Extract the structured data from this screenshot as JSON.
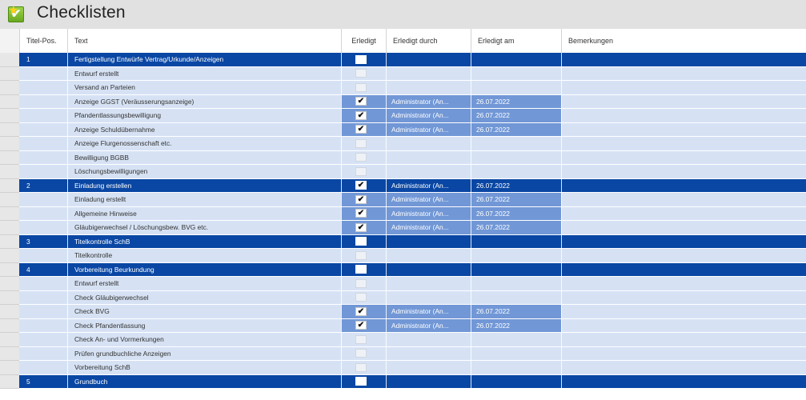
{
  "window": {
    "title": "Checklisten"
  },
  "columns": {
    "pos": "Titel-Pos.",
    "text": "Text",
    "done": "Erledigt",
    "done_by": "Erledigt durch",
    "done_at": "Erledigt am",
    "remarks": "Bemerkungen"
  },
  "rows": [
    {
      "kind": "group",
      "pos": "1",
      "text": "Fertigstellung Entwürfe Vertrag/Urkunde/Anzeigen",
      "checked": false,
      "by": "",
      "at": ""
    },
    {
      "kind": "item",
      "pos": "",
      "text": "Entwurf erstellt",
      "checked": false,
      "by": "",
      "at": ""
    },
    {
      "kind": "item",
      "pos": "",
      "text": "Versand an Parteien",
      "checked": false,
      "by": "",
      "at": ""
    },
    {
      "kind": "item",
      "pos": "",
      "text": "Anzeige GGST (Veräusserungsanzeige)",
      "checked": true,
      "by": "Administrator (An...",
      "at": "26.07.2022"
    },
    {
      "kind": "item",
      "pos": "",
      "text": "Pfandentlassungsbewilligung",
      "checked": true,
      "by": "Administrator (An...",
      "at": "26.07.2022"
    },
    {
      "kind": "item",
      "pos": "",
      "text": "Anzeige Schuldübernahme",
      "checked": true,
      "by": "Administrator (An...",
      "at": "26.07.2022"
    },
    {
      "kind": "item",
      "pos": "",
      "text": "Anzeige Flurgenossenschaft etc.",
      "checked": false,
      "by": "",
      "at": ""
    },
    {
      "kind": "item",
      "pos": "",
      "text": "Bewilligung BGBB",
      "checked": false,
      "by": "",
      "at": ""
    },
    {
      "kind": "item",
      "pos": "",
      "text": "Löschungsbewilligungen",
      "checked": false,
      "by": "",
      "at": ""
    },
    {
      "kind": "group",
      "pos": "2",
      "text": "Einladung erstellen",
      "checked": true,
      "by": "Administrator (An...",
      "at": "26.07.2022"
    },
    {
      "kind": "item",
      "pos": "",
      "text": "Einladung erstellt",
      "checked": true,
      "by": "Administrator (An...",
      "at": "26.07.2022"
    },
    {
      "kind": "item",
      "pos": "",
      "text": "Allgemeine Hinweise",
      "checked": true,
      "by": "Administrator (An...",
      "at": "26.07.2022"
    },
    {
      "kind": "item",
      "pos": "",
      "text": "Gläubigerwechsel / Löschungsbew. BVG etc.",
      "checked": true,
      "by": "Administrator (An...",
      "at": "26.07.2022"
    },
    {
      "kind": "group",
      "pos": "3",
      "text": "Titelkontrolle SchB",
      "checked": false,
      "by": "",
      "at": ""
    },
    {
      "kind": "item",
      "pos": "",
      "text": "Titelkontrolle",
      "checked": false,
      "by": "",
      "at": ""
    },
    {
      "kind": "group",
      "pos": "4",
      "text": "Vorbereitung Beurkundung",
      "checked": false,
      "by": "",
      "at": ""
    },
    {
      "kind": "item",
      "pos": "",
      "text": "Entwurf erstellt",
      "checked": false,
      "by": "",
      "at": ""
    },
    {
      "kind": "item",
      "pos": "",
      "text": "Check Gläubigerwechsel",
      "checked": false,
      "by": "",
      "at": ""
    },
    {
      "kind": "item",
      "pos": "",
      "text": "Check BVG",
      "checked": true,
      "by": "Administrator (An...",
      "at": "26.07.2022"
    },
    {
      "kind": "item",
      "pos": "",
      "text": "Check Pfandentlassung",
      "checked": true,
      "by": "Administrator (An...",
      "at": "26.07.2022"
    },
    {
      "kind": "item",
      "pos": "",
      "text": "Check An- und Vormerkungen",
      "checked": false,
      "by": "",
      "at": ""
    },
    {
      "kind": "item",
      "pos": "",
      "text": "Prüfen grundbuchliche Anzeigen",
      "checked": false,
      "by": "",
      "at": ""
    },
    {
      "kind": "item",
      "pos": "",
      "text": "Vorbereitung SchB",
      "checked": false,
      "by": "",
      "at": ""
    },
    {
      "kind": "group",
      "pos": "5",
      "text": "Grundbuch",
      "checked": false,
      "by": "",
      "at": ""
    }
  ],
  "check_glyph": "✔",
  "colors": {
    "group_row": "#0a47a4",
    "item_row": "#d6e2f4",
    "completed_cell": "#7197d6",
    "titlebar": "#e1e1e1"
  }
}
